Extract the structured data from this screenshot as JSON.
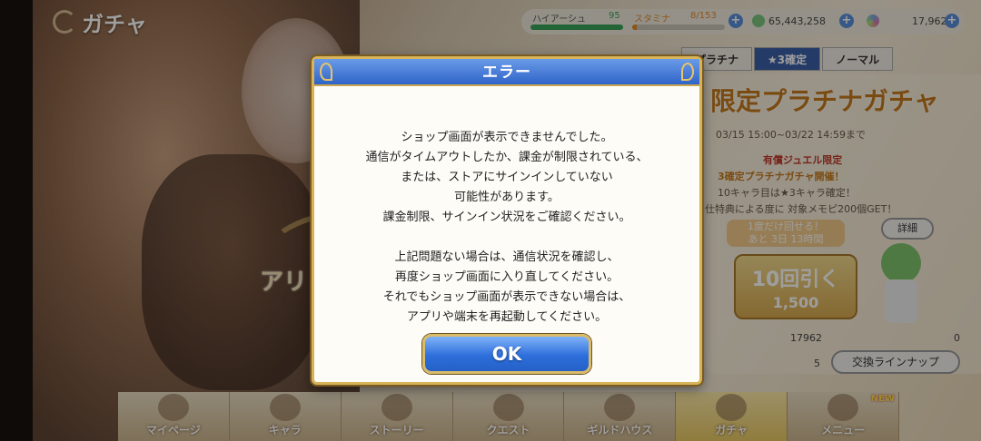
{
  "header": {
    "title": "ガチャ",
    "stats": [
      {
        "label": "ハイアーシュ",
        "value": "95",
        "fill": 1.0,
        "color": "#3aa35a"
      },
      {
        "label": "スタミナ",
        "value": "8/153",
        "fill": 0.05,
        "color": "#e08a2a"
      }
    ],
    "currencies": [
      {
        "icon": "mana-coin-icon",
        "value": "65,443,258"
      },
      {
        "icon": "jewel-icon",
        "value": "17,962"
      }
    ]
  },
  "gacha_tabs": [
    {
      "label": "プラチナ",
      "active": false
    },
    {
      "label": "★3確定",
      "active": true
    },
    {
      "label": "ノーマル",
      "active": false
    }
  ],
  "banner": {
    "title": "限定プラチナガチャ",
    "period": "03/15 15:00~03/22 14:59まで",
    "line1": "有償ジュエル限定",
    "line2": "3確定プラチナガチャ開催！",
    "line3": "10キャラ目は★3キャラ確定！",
    "line4": "仕特典による度に 対象メモピ200個GET！",
    "detail_label": "詳細",
    "timer_line1": "1度だけ回せる！",
    "timer_line2": "あと 3日 13時間",
    "ten_pull_label": "10回引く",
    "ten_pull_cost": "1,500",
    "owned_count": "17962",
    "owned_count2": "0",
    "exchange_count": "5",
    "exchange_label": "交換ラインナップ",
    "left_text": "アリ"
  },
  "dialog": {
    "title": "エラー",
    "paragraph1": [
      "ショップ画面が表示できませんでした。",
      "通信がタイムアウトしたか、課金が制限されている、",
      "または、ストアにサインインしていない",
      "可能性があります。",
      "課金制限、サインイン状況をご確認ください。"
    ],
    "paragraph2": [
      "上記問題ない場合は、通信状況を確認し、",
      "再度ショップ画面に入り直してください。",
      "それでもショップ画面が表示できない場合は、",
      "アプリや端末を再起動してください。"
    ],
    "ok_label": "OK"
  },
  "nav": [
    {
      "label": "マイページ",
      "icon": "home-icon",
      "active": false,
      "new": false
    },
    {
      "label": "キャラ",
      "icon": "character-icon",
      "active": false,
      "new": false
    },
    {
      "label": "ストーリー",
      "icon": "story-icon",
      "active": false,
      "new": false
    },
    {
      "label": "クエスト",
      "icon": "quest-icon",
      "active": false,
      "new": false
    },
    {
      "label": "ギルドハウス",
      "icon": "guild-house-icon",
      "active": false,
      "new": false
    },
    {
      "label": "ガチャ",
      "icon": "gacha-icon",
      "active": true,
      "new": false
    },
    {
      "label": "メニュー",
      "icon": "menu-icon",
      "active": false,
      "new": true
    }
  ],
  "nav_new_badge": "NEW"
}
